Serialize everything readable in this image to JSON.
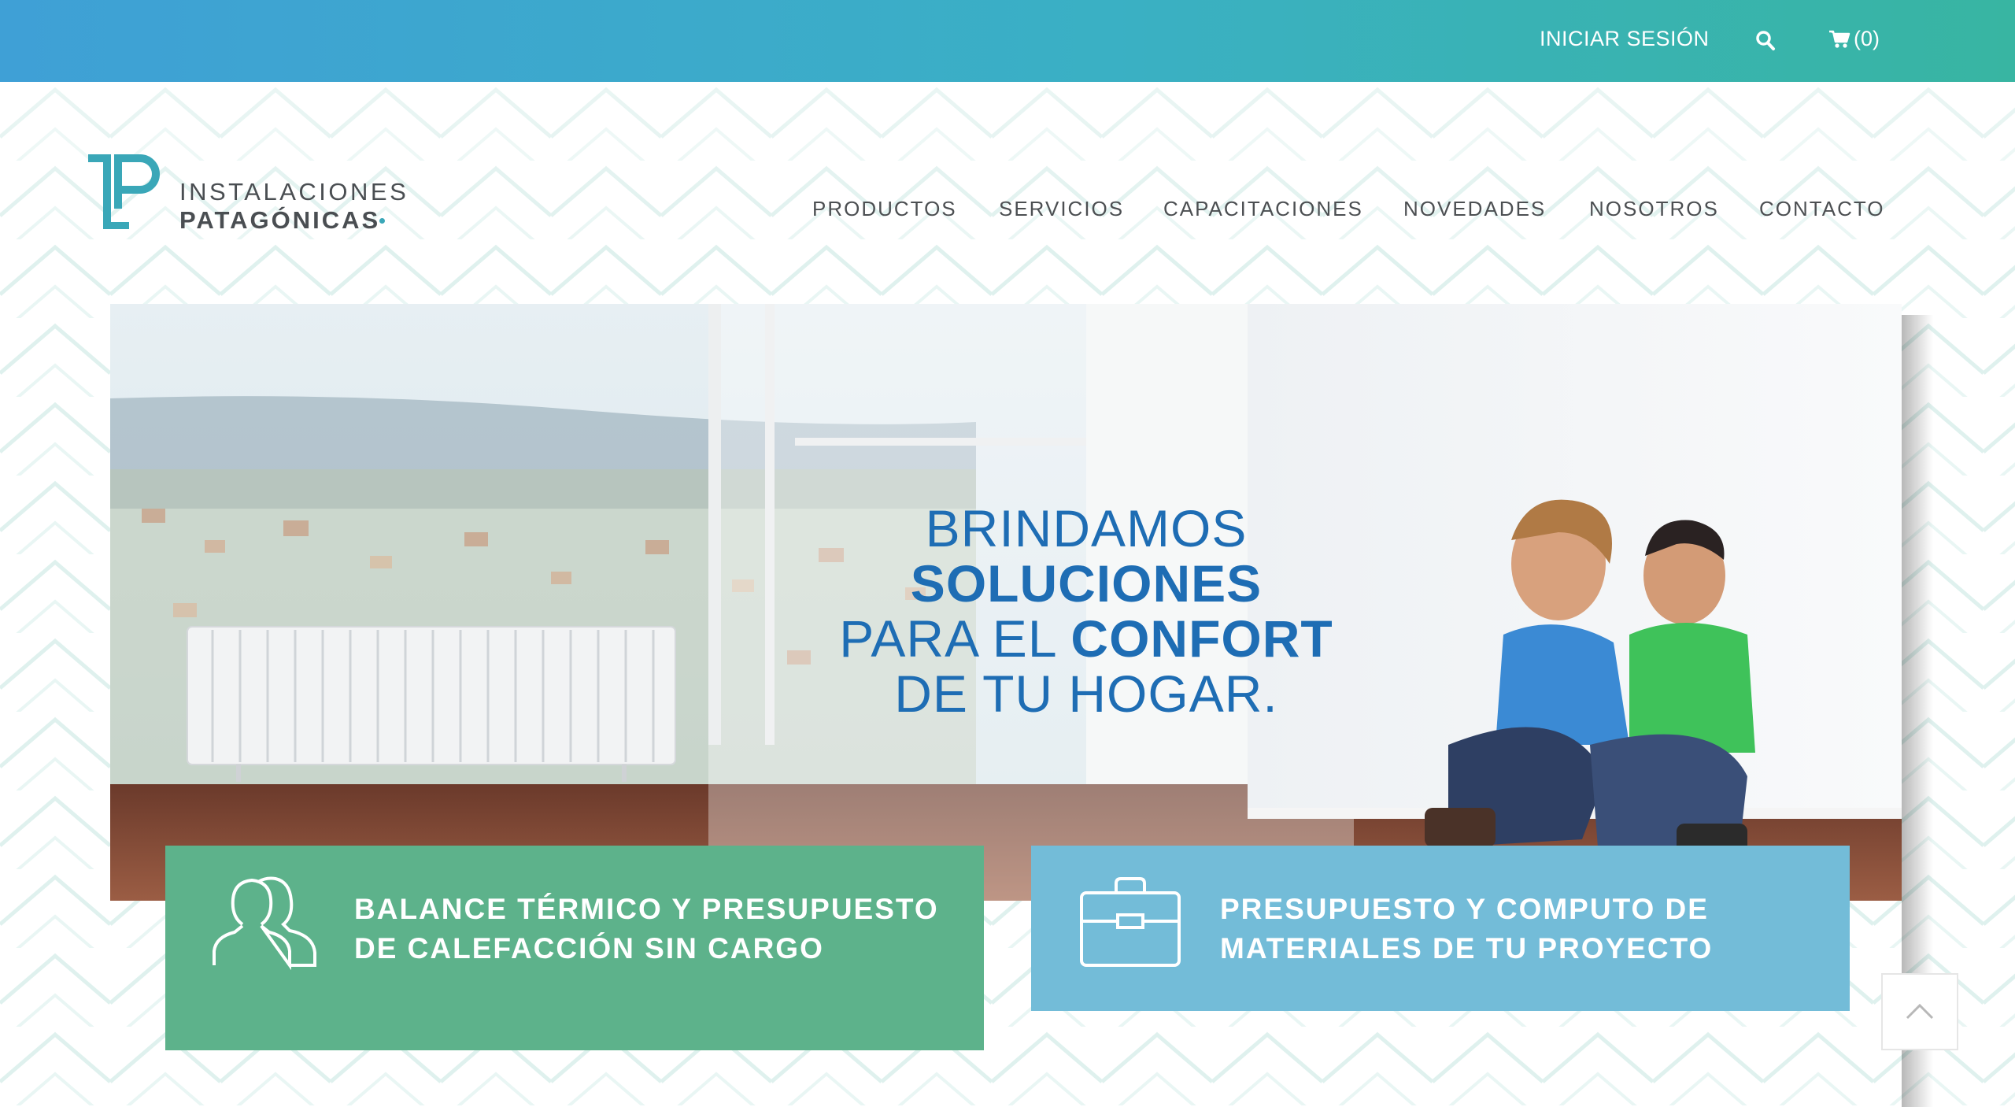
{
  "topbar": {
    "login_label": "INICIAR SESIÓN",
    "search_icon": "search-icon",
    "cart_icon": "cart-icon",
    "cart_count": "(0)"
  },
  "logo": {
    "line1": "INSTALACIONES",
    "line2": "PATAGÓNICAS"
  },
  "nav": {
    "items": [
      "PRODUCTOS",
      "SERVICIOS",
      "CAPACITACIONES",
      "NOVEDADES",
      "NOSOTROS",
      "CONTACTO"
    ]
  },
  "hero": {
    "line1": "BRINDAMOS",
    "line2": "SOLUCIONES",
    "line3_a": "PARA EL ",
    "line3_b": "CONFORT",
    "line4": "DE TU HOGAR."
  },
  "cards": [
    {
      "icon": "user-icon",
      "text": "BALANCE TÉRMICO Y PRESUPUESTO DE CALEFACCIÓN SIN CARGO"
    },
    {
      "icon": "briefcase-icon",
      "text": "PRESUPUESTO Y COMPUTO DE MATERIALES DE TU PROYECTO"
    }
  ],
  "scroll_top_icon": "chevron-up-icon",
  "colors": {
    "brand_teal": "#3aa7b8",
    "nav_text": "#4c4f52",
    "hero_blue": "#1e6db4",
    "card_green": "#5db28b",
    "card_blue": "#73bcd8"
  }
}
